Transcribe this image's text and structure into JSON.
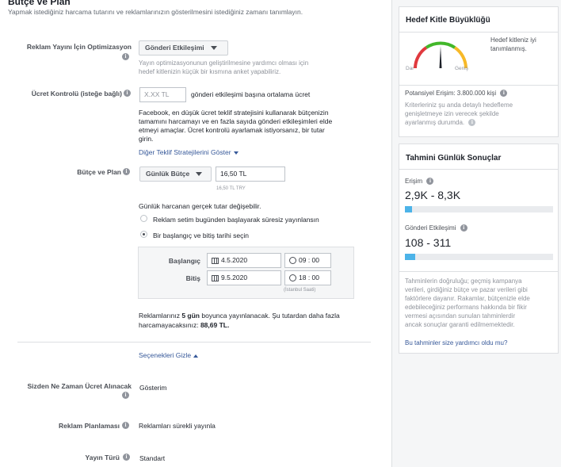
{
  "section": {
    "title": "Bütçe ve Plan",
    "description": "Yapmak istediğiniz harcama tutarını ve reklamlarınızın gösterilmesini istediğiniz zamanı tanımlayın."
  },
  "optimization": {
    "label": "Reklam Yayını İçin Optimizasyon",
    "value": "Gönderi Etkileşimi",
    "help": [
      "Yayın optimizasyonunun geliştirilmesine yardımcı olması için",
      "hedef kitlenizin küçük bir kısmına anket yapabiliriz."
    ]
  },
  "bid": {
    "label": "Ücret Kontrolü (isteğe bağlı)",
    "placeholder": "X.XX TL",
    "suffix": "gönderi etkileşimi başına ortalama ücret",
    "desc": [
      "Facebook, en düşük ücret teklif stratejisini kullanarak bütçenizin",
      "tamamını harcamayı ve en fazla sayıda gönderi etkileşimleri elde",
      "etmeyi amaçlar. Ücret kontrolü ayarlamak istiyorsanız, bir tutar",
      "girin."
    ],
    "link": "Diğer Teklif Stratejilerini Göster"
  },
  "budget": {
    "label": "Bütçe ve Plan",
    "type": "Günlük Bütçe",
    "amount": "16,50 TL",
    "amount_hint": "16,50 TL TRY",
    "note": "Günlük harcanan gerçek tutar değişebilir.",
    "options": [
      {
        "label": "Reklam setim bugünden başlayarak süresiz yayınlansın",
        "selected": false
      },
      {
        "label": "Bir başlangıç ve bitiş tarihi seçin",
        "selected": true
      }
    ],
    "start_label": "Başlangıç",
    "start_date": "4.5.2020",
    "start_time": "09 : 00",
    "end_label": "Bitiş",
    "end_date": "9.5.2020",
    "end_time": "18 : 00",
    "timezone": "(İstanbul Saati)",
    "summary_pre": "Reklamlarınız ",
    "summary_days": "5 gün",
    "summary_mid": " boyunca yayınlanacak. Şu tutardan daha fazla",
    "summary_pre2": "harcamayacaksınız: ",
    "summary_amount": "88,69 TL."
  },
  "toggle_link": "Seçenekleri Gizle",
  "billing": {
    "label": "Sizden Ne Zaman Ücret Alınacak",
    "value": "Gösterim"
  },
  "schedule": {
    "label": "Reklam Planlaması",
    "value": "Reklamları sürekli yayınla"
  },
  "delivery": {
    "label": "Yayın Türü",
    "value": "Standart"
  },
  "audience": {
    "title": "Hedef Kitle Büyüklüğü",
    "status": [
      "Hedef kitleniz iyi",
      "tanımlanmış."
    ],
    "narrow": "Dar",
    "broad": "Geniş",
    "potential": "Potansiyel Erişim: 3.800.000 kişi",
    "criteria": [
      "Kriterleriniz şu anda detaylı hedefleme",
      "genişletmeye izin verecek şekilde",
      "ayarlanmış durumda."
    ],
    "gauge_level": 0.5,
    "colors": {
      "low": "#e0393e",
      "mid": "#42b72a",
      "high": "#f7b928",
      "needle": "#1d2129"
    }
  },
  "daily_results": {
    "title": "Tahmini Günlük Sonuçlar",
    "reach_label": "Erişim",
    "reach_value": "2,9K - 8,3K",
    "reach_fraction": 0.05,
    "engagement_label": "Gönderi Etkileşimi",
    "engagement_value": "108 - 311",
    "engagement_fraction": 0.07,
    "disclaimer": [
      "Tahminlerin doğruluğu; geçmiş kampanya",
      "verileri, girdiğiniz bütçe ve pazar verileri gibi",
      "faktörlere dayanır. Rakamlar, bütçenizle elde",
      "edebileceğiniz performans hakkında bir fikir",
      "vermesi açısından sunulan tahminlerdir",
      "ancak sonuçlar garanti edilmemektedir."
    ],
    "helpful_link": "Bu tahminler size yardımcı oldu mu?"
  }
}
